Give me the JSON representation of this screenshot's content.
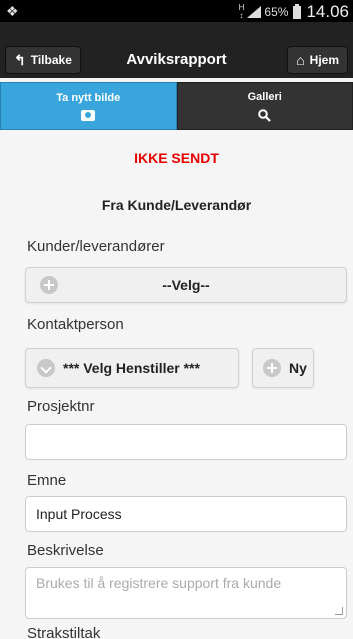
{
  "statusbar": {
    "network": "H",
    "battery_pct": "65%",
    "time": "14.06"
  },
  "header": {
    "back_label": "Tilbake",
    "title": "Avviksrapport",
    "home_label": "Hjem"
  },
  "tabs": [
    {
      "label": "Ta nytt bilde",
      "icon": "camera-icon",
      "active": true
    },
    {
      "label": "Galleri",
      "icon": "search-icon",
      "active": false
    }
  ],
  "form": {
    "status": "IKKE SENDT",
    "subtitle": "Fra Kunde/Leverandør",
    "customer_label": "Kunder/leverandører",
    "customer_select": "--Velg--",
    "contact_label": "Kontaktperson",
    "contact_select": "*** Velg Henstiller ***",
    "new_button": "Ny",
    "project_label": "Prosjektnr",
    "project_value": "",
    "subject_label": "Emne",
    "subject_value": "Input Process",
    "description_label": "Beskrivelse",
    "description_placeholder": "Brukes til å registrere support fra kunde",
    "immediate_label": "Strakstiltak"
  },
  "colors": {
    "accent": "#38a6dc",
    "status_red": "#e60000",
    "header_bg": "#222222"
  }
}
